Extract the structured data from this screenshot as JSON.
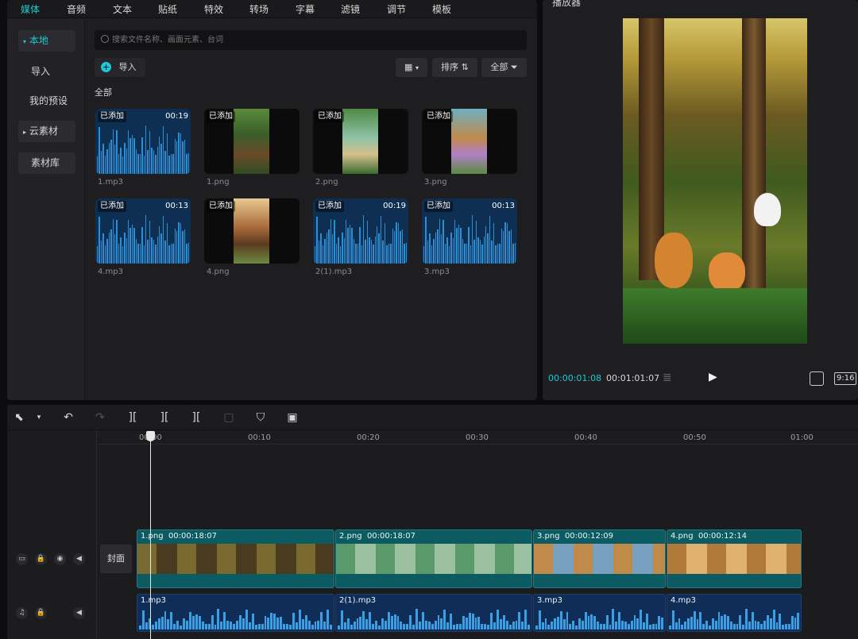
{
  "top_tabs": [
    {
      "label": "媒体",
      "active": true
    },
    {
      "label": "音频"
    },
    {
      "label": "文本"
    },
    {
      "label": "贴纸"
    },
    {
      "label": "特效"
    },
    {
      "label": "转场"
    },
    {
      "label": "字幕"
    },
    {
      "label": "滤镜"
    },
    {
      "label": "调节"
    },
    {
      "label": "模板"
    }
  ],
  "sidebar": {
    "items": [
      {
        "label": "本地",
        "active": true,
        "arrow": "▾"
      },
      {
        "label": "导入"
      },
      {
        "label": "我的预设"
      },
      {
        "label": "云素材",
        "arrow": "▸"
      },
      {
        "label": "素材库"
      }
    ]
  },
  "media": {
    "search_placeholder": "搜索文件名称、画面元素、台词",
    "import_label": "导入",
    "sort_label": "排序",
    "filter_label": "全部",
    "section_label": "全部",
    "added_badge": "已添加",
    "items": [
      {
        "name": "1.mp3",
        "type": "audio",
        "duration": "00:19"
      },
      {
        "name": "1.png",
        "type": "image"
      },
      {
        "name": "2.png",
        "type": "image"
      },
      {
        "name": "3.png",
        "type": "image"
      },
      {
        "name": "4.mp3",
        "type": "audio",
        "duration": "00:13"
      },
      {
        "name": "4.png",
        "type": "image"
      },
      {
        "name": "2(1).mp3",
        "type": "audio",
        "duration": "00:19"
      },
      {
        "name": "3.mp3",
        "type": "audio",
        "duration": "00:13"
      }
    ]
  },
  "player": {
    "title": "播放器",
    "current_time": "00:00:01:08",
    "total_time": "00:01:01:07",
    "ratio": "9:16"
  },
  "timeline": {
    "ruler": [
      "00:00",
      "00:10",
      "00:20",
      "00:30",
      "00:40",
      "00:50",
      "01:00"
    ],
    "cover_label": "封面",
    "video_clips": [
      {
        "name": "1.png",
        "duration": "00:00:18:07"
      },
      {
        "name": "2.png",
        "duration": "00:00:18:07"
      },
      {
        "name": "3.png",
        "duration": "00:00:12:09"
      },
      {
        "name": "4.png",
        "duration": "00:00:12:14"
      }
    ],
    "audio_clips": [
      {
        "name": "1.mp3"
      },
      {
        "name": "2(1).mp3"
      },
      {
        "name": "3.mp3"
      },
      {
        "name": "4.mp3"
      }
    ]
  },
  "colors": {
    "accent": "#1ec8d4",
    "video_clip": "#0c5b62",
    "audio_clip": "#102d58"
  }
}
